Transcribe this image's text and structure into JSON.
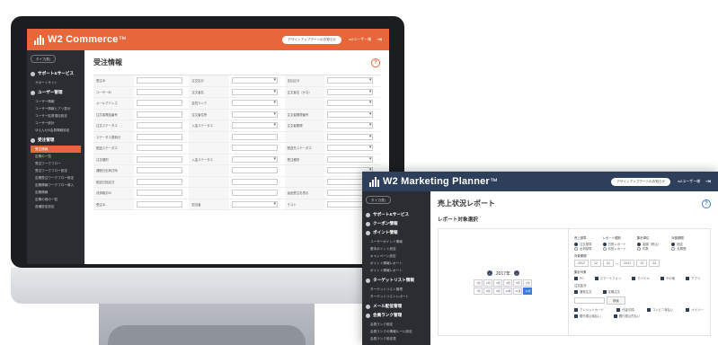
{
  "screen1": {
    "app_name": "W2 Commerce",
    "app_name_tm": "™",
    "header_button": "デザインアップデートのお知らせ",
    "user_label": "w2ユーザー様",
    "logout_icon": "logout-icon",
    "sidebar": {
      "tag": "タイプ(表)",
      "sections": [
        {
          "label": "サポート&サービス",
          "items": [
            "サポートサイト"
          ]
        },
        {
          "label": "ユーザー管理",
          "items": [
            "ユーザー情報",
            "ユーザー情報ヒアリ表示",
            "ユーザー拡張項目設定",
            "ユーザー統計",
            "ゆえんせ&会員情報設定"
          ]
        },
        {
          "label": "受注管理",
          "items": [
            "受注情報",
            "定期の一覧",
            "受注ワークフロー",
            "受注ワークフロー設定",
            "定期受注ワークフロー設定",
            "定期情報ワークフロー導入",
            "定期情報",
            "定期の他の一覧",
            "各種設定設定"
          ]
        }
      ],
      "active_item": "受注情報"
    },
    "title": "受注情報",
    "help_icon": "?",
    "form": [
      [
        "受注ID",
        "注文区分",
        "支払区分"
      ],
      [
        "ユーザーID",
        "注文者名",
        "注文者名（かな）"
      ],
      [
        "メールアドレス",
        "会員ランク",
        ""
      ],
      [
        "注文者電話番号",
        "注文者住所",
        "注文者郵便番号"
      ],
      [
        "注文ステータス",
        "入金ステータス",
        "注文者郵便"
      ],
      [
        "ステータス更新日",
        "",
        ""
      ],
      [
        "配送ステータス",
        "",
        "配送先ステータス"
      ],
      [
        "注文種別",
        "入金ステータス",
        "受注種別"
      ],
      [
        "通販日出荷日時",
        "",
        ""
      ],
      [
        "配送日指定日",
        "",
        ""
      ],
      [
        "決済取引ID",
        "",
        "返品受注を表示"
      ],
      [
        "受注ID",
        "担当者",
        "テスト"
      ]
    ]
  },
  "screen2": {
    "app_name": "W2 Marketing Planner",
    "app_name_tm": "™",
    "header_button": "デザインアップデートのお知らせ",
    "user_label": "w2ユーザー様",
    "sidebar": {
      "tag": "タイプ(表)",
      "sections": [
        {
          "label": "サポート&サービス",
          "items": []
        },
        {
          "label": "クーポン情報",
          "items": []
        },
        {
          "label": "ポイント情報",
          "items": [
            "ユーザーポイント情報",
            "基本ポイント設定",
            "キャンペーン設定",
            "ポイント情報レポート",
            "ポイント情報レポート"
          ]
        },
        {
          "label": "ターゲットリスト情報",
          "items": [
            "ターゲットリスト管理",
            "ターゲットリストレポート"
          ]
        },
        {
          "label": "メール配信管理",
          "items": []
        },
        {
          "label": "会員ランク管理",
          "items": [
            "会員ランク設定",
            "会員ランクの情報ルール設定",
            "会員ランク設定表"
          ]
        }
      ]
    },
    "title": "売上状況レポート",
    "subtitle": "レポート対象選択",
    "report_type_label": "対象期間",
    "year_label": "2017年",
    "months": [
      "1月",
      "2月",
      "3月",
      "4月",
      "5月",
      "6月",
      "7月",
      "8月",
      "9月",
      "10月",
      "11月",
      "12月"
    ],
    "active_month": "12月",
    "groups": [
      {
        "label": "売上基準",
        "options": [
          "注文基準",
          "出荷基準"
        ]
      },
      {
        "label": "レポート種別",
        "options": [
          "日別レポート",
          "月別レポート"
        ]
      },
      {
        "label": "集計単位",
        "options": [
          "金額（税込）",
          "件数"
        ]
      },
      {
        "label": "対象期間",
        "options": [
          "指定",
          "全期間"
        ]
      }
    ],
    "date_from": [
      "2017",
      "12",
      "01"
    ],
    "date_to": [
      "2017",
      "12",
      "31"
    ],
    "checkbox_groups": [
      {
        "label": "集計対象",
        "options": [
          "PC",
          "スマートフォン",
          "モバイル",
          "その他",
          "アプリ"
        ]
      },
      {
        "label": "注文区分",
        "options": [
          "通常注文",
          "定期注文"
        ]
      }
    ],
    "search_button": "検索",
    "footer_options": [
      "クレジットカード",
      "代金引換",
      "コンビニ後払い",
      "ペイジー",
      "銀行振込後払い",
      "銀行振込先払い"
    ]
  }
}
